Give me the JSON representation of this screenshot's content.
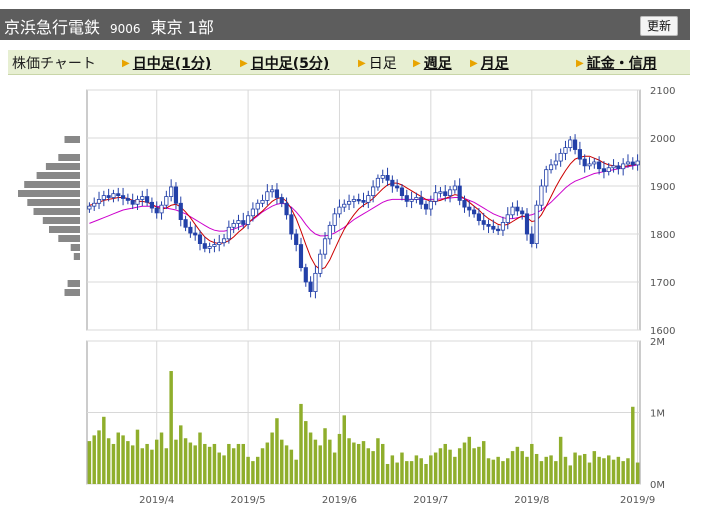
{
  "header": {
    "company": "京浜急行電鉄",
    "code": "9006",
    "market": "東京 1部",
    "update_label": "更新"
  },
  "nav": {
    "label": "株価チャート",
    "tabs": [
      {
        "label": "日中足(1分)",
        "state": "link"
      },
      {
        "label": "日中足(5分)",
        "state": "link"
      },
      {
        "label": "日足",
        "state": "current"
      },
      {
        "label": "週足",
        "state": "link"
      },
      {
        "label": "月足",
        "state": "link"
      },
      {
        "label": "証金・信用",
        "state": "link"
      }
    ]
  },
  "colors": {
    "candle": "#2340a8",
    "ma_short": "#cc0000",
    "ma_long": "#cc00cc",
    "volume": "#8fae2c",
    "profile": "#888888",
    "grid": "#d8d8d8"
  },
  "chart_data": [
    {
      "type": "candlestick",
      "title": "",
      "x_ticks": [
        "2019/4",
        "2019/5",
        "2019/6",
        "2019/7",
        "2019/8",
        "2019/9"
      ],
      "x_tick_index": [
        14,
        33,
        52,
        71,
        92,
        114
      ],
      "y_ticks": [
        1600,
        1700,
        1800,
        1900,
        2000,
        2100
      ],
      "ylim": [
        1600,
        2100
      ],
      "grid": true,
      "closes": [
        1858,
        1864,
        1872,
        1880,
        1876,
        1884,
        1880,
        1874,
        1870,
        1862,
        1872,
        1878,
        1866,
        1854,
        1844,
        1860,
        1878,
        1898,
        1864,
        1830,
        1814,
        1802,
        1798,
        1780,
        1770,
        1774,
        1778,
        1782,
        1790,
        1814,
        1822,
        1828,
        1820,
        1838,
        1852,
        1864,
        1870,
        1888,
        1892,
        1876,
        1864,
        1840,
        1800,
        1778,
        1730,
        1700,
        1680,
        1718,
        1758,
        1790,
        1818,
        1842,
        1856,
        1862,
        1868,
        1872,
        1870,
        1866,
        1880,
        1898,
        1916,
        1922,
        1912,
        1900,
        1896,
        1880,
        1868,
        1872,
        1876,
        1862,
        1852,
        1868,
        1886,
        1888,
        1880,
        1892,
        1900,
        1870,
        1856,
        1850,
        1842,
        1828,
        1820,
        1816,
        1810,
        1808,
        1824,
        1840,
        1856,
        1848,
        1842,
        1800,
        1780,
        1860,
        1900,
        1934,
        1944,
        1952,
        1968,
        1980,
        1996,
        1976,
        1956,
        1942,
        1946,
        1950,
        1936,
        1930,
        1938,
        1942,
        1936,
        1946,
        1950,
        1944,
        1952
      ],
      "ma_short": [
        1860,
        1862,
        1866,
        1870,
        1872,
        1874,
        1876,
        1876,
        1874,
        1870,
        1868,
        1868,
        1866,
        1862,
        1856,
        1852,
        1854,
        1860,
        1862,
        1856,
        1846,
        1834,
        1820,
        1806,
        1794,
        1786,
        1782,
        1780,
        1782,
        1786,
        1794,
        1804,
        1812,
        1822,
        1832,
        1840,
        1848,
        1858,
        1868,
        1874,
        1876,
        1868,
        1852,
        1832,
        1806,
        1778,
        1752,
        1734,
        1726,
        1730,
        1746,
        1768,
        1790,
        1810,
        1826,
        1840,
        1852,
        1860,
        1866,
        1874,
        1884,
        1894,
        1902,
        1906,
        1906,
        1902,
        1896,
        1890,
        1884,
        1878,
        1872,
        1868,
        1868,
        1870,
        1874,
        1878,
        1882,
        1880,
        1874,
        1866,
        1858,
        1850,
        1840,
        1832,
        1826,
        1820,
        1818,
        1820,
        1826,
        1832,
        1838,
        1834,
        1826,
        1828,
        1840,
        1858,
        1878,
        1898,
        1916,
        1932,
        1946,
        1956,
        1960,
        1962,
        1962,
        1958,
        1954,
        1948,
        1944,
        1942,
        1940,
        1940,
        1942,
        1944,
        1946
      ],
      "ma_long": [
        1822,
        1826,
        1830,
        1834,
        1838,
        1842,
        1846,
        1850,
        1852,
        1854,
        1856,
        1858,
        1858,
        1858,
        1858,
        1856,
        1854,
        1852,
        1850,
        1846,
        1842,
        1836,
        1830,
        1824,
        1818,
        1812,
        1808,
        1806,
        1806,
        1808,
        1810,
        1814,
        1818,
        1824,
        1830,
        1838,
        1846,
        1852,
        1858,
        1862,
        1864,
        1862,
        1856,
        1846,
        1834,
        1820,
        1808,
        1800,
        1796,
        1796,
        1798,
        1802,
        1808,
        1814,
        1822,
        1830,
        1836,
        1842,
        1848,
        1854,
        1860,
        1866,
        1870,
        1872,
        1872,
        1872,
        1872,
        1872,
        1872,
        1872,
        1872,
        1872,
        1872,
        1873,
        1874,
        1875,
        1876,
        1876,
        1874,
        1870,
        1866,
        1860,
        1854,
        1848,
        1842,
        1838,
        1834,
        1832,
        1832,
        1834,
        1836,
        1838,
        1840,
        1844,
        1850,
        1858,
        1866,
        1876,
        1886,
        1896,
        1904,
        1910,
        1914,
        1918,
        1922,
        1926,
        1928,
        1930,
        1932,
        1934,
        1936,
        1938,
        1940,
        1942,
        1944
      ]
    },
    {
      "type": "bar",
      "title": "",
      "y_ticks_labels": [
        "0M",
        "1M",
        "2M"
      ],
      "ylim": [
        0,
        2000000
      ],
      "values": [
        600000,
        680000,
        750000,
        940000,
        640000,
        560000,
        720000,
        680000,
        600000,
        540000,
        760000,
        500000,
        560000,
        480000,
        620000,
        720000,
        500000,
        1580000,
        620000,
        820000,
        640000,
        580000,
        540000,
        720000,
        560000,
        520000,
        560000,
        440000,
        400000,
        560000,
        500000,
        560000,
        560000,
        380000,
        320000,
        380000,
        500000,
        580000,
        720000,
        920000,
        620000,
        540000,
        480000,
        340000,
        1120000,
        880000,
        720000,
        620000,
        540000,
        780000,
        620000,
        440000,
        700000,
        960000,
        640000,
        580000,
        560000,
        600000,
        500000,
        460000,
        640000,
        560000,
        280000,
        400000,
        300000,
        440000,
        320000,
        320000,
        400000,
        360000,
        280000,
        400000,
        440000,
        500000,
        560000,
        480000,
        380000,
        500000,
        580000,
        660000,
        500000,
        520000,
        600000,
        360000,
        340000,
        380000,
        320000,
        360000,
        460000,
        520000,
        460000,
        380000,
        560000,
        420000,
        320000,
        380000,
        400000,
        320000,
        660000,
        380000,
        260000,
        440000,
        400000,
        420000,
        300000,
        460000,
        380000,
        360000,
        400000,
        340000,
        380000,
        320000,
        360000,
        1080000,
        300000
      ]
    }
  ],
  "profile_bins": [
    0.25,
    0,
    0.35,
    0.55,
    0.7,
    0.9,
    1.0,
    0.85,
    0.75,
    0.6,
    0.5,
    0.35,
    0.15,
    0.1,
    0,
    0,
    0.2,
    0.25
  ]
}
